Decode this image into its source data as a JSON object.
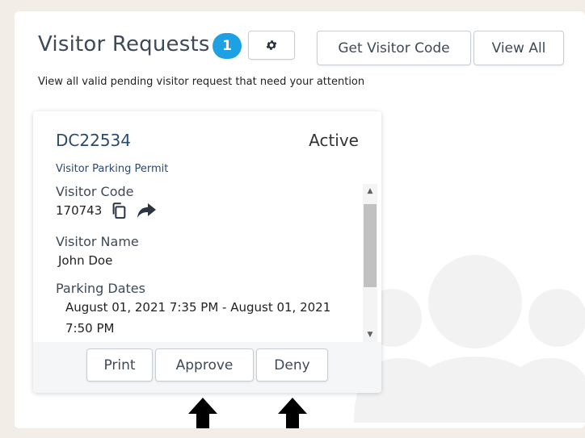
{
  "header": {
    "title": "Visitor Requests",
    "badge_count": "1",
    "subtitle": "View all valid pending visitor request that need your attention",
    "get_visitor_code_label": "Get Visitor Code",
    "view_all_label": "View All"
  },
  "request": {
    "id": "DC22534",
    "status": "Active",
    "type": "Visitor Parking Permit",
    "visitor_code_label": "Visitor Code",
    "visitor_code": "170743",
    "visitor_name_label": "Visitor Name",
    "visitor_name": "John Doe",
    "parking_dates_label": "Parking Dates",
    "parking_dates": "August 01, 2021 7:35 PM - August 01, 2021 7:50 PM"
  },
  "actions": {
    "print_label": "Print",
    "approve_label": "Approve",
    "deny_label": "Deny"
  },
  "icons": {
    "settings": "gear-icon",
    "copy": "copy-icon",
    "share": "share-icon",
    "scroll_up": "scroll-up-arrow-icon",
    "scroll_down": "scroll-down-arrow-icon",
    "annotation": "up-arrow-icon"
  },
  "colors": {
    "badge": "#1ea1e3",
    "id_text": "#2b4a6e",
    "page_background": "#f2ede6"
  }
}
